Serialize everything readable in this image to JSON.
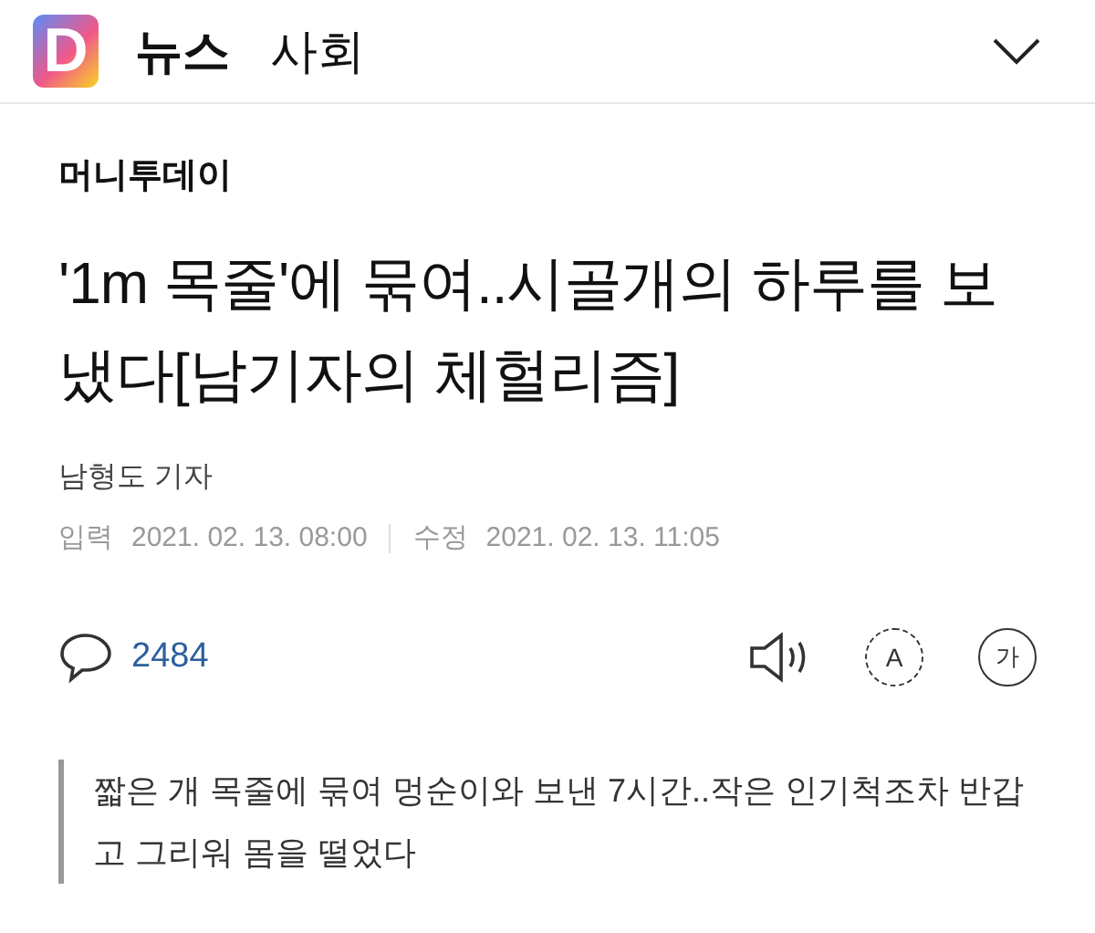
{
  "header": {
    "logo": "D",
    "section": "뉴스",
    "category": "사회"
  },
  "article": {
    "press": "머니투데이",
    "title": "'1m 목줄'에 묶여..시골개의 하루를 보냈다[남기자의 체헐리즘]",
    "reporter": "남형도 기자",
    "dates": [
      {
        "label": "입력",
        "value": "2021. 02. 13. 08:00"
      },
      {
        "label": "수정",
        "value": "2021. 02. 13. 11:05"
      }
    ],
    "comments": "2484",
    "translate_label": "A",
    "font_size_label": "가",
    "summary": "짧은 개 목줄에 묶여 멍순이와 보낸 7시간..작은 인기척조차 반갑고 그리워 몸을 떨었다"
  }
}
